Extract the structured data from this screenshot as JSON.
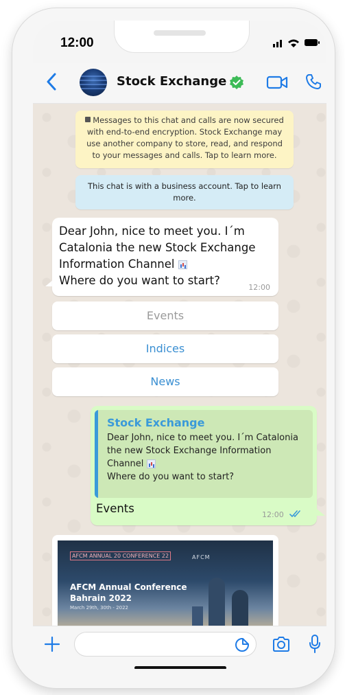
{
  "status": {
    "time": "12:00"
  },
  "header": {
    "contact_name": "Stock Exchange",
    "verified": true
  },
  "chat": {
    "encryption_notice": "Messages to this chat and calls are now secured with end-to-end encryption. Stock Exchange may use another company to store, read, and respond to your messages and calls. Tap to learn more.",
    "business_notice": "This chat is with a business account. Tap to learn more.",
    "incoming_message": {
      "line1": "Dear John, nice to meet you. I´m",
      "line2": "Catalonia the new Stock Exchange",
      "line3": "Information Channel",
      "line4": "Where do you want to start?",
      "time": "12:00"
    },
    "quick_replies": [
      {
        "label": "Events"
      },
      {
        "label": "Indices"
      },
      {
        "label": "News"
      }
    ],
    "outgoing_message": {
      "quoted_sender": "Stock Exchange",
      "quoted_line1": "Dear John, nice to meet you. I´m Catalonia",
      "quoted_line2": "the new Stock Exchange Information",
      "quoted_line3": "Channel",
      "quoted_line4": "Where do you want to start?",
      "text": "Events",
      "time": "12:00",
      "status": "read"
    },
    "card": {
      "tag": "AFCM ANNUAL 20 CONFERENCE 22",
      "logos": "AFCM",
      "title": "AFCM Annual Conference Bahrain 2022",
      "date": "March 29th, 30th - 2022"
    }
  },
  "input": {
    "placeholder": "",
    "value": ""
  },
  "colors": {
    "accent": "#1e7be6",
    "verified": "#3dbb57",
    "outgoing_bubble": "#d9fbc6",
    "incoming_bubble": "#ffffff",
    "link": "#3a8fd2"
  },
  "icons": [
    "back-icon",
    "verified-icon",
    "video-call-icon",
    "phone-icon",
    "plus-icon",
    "sticker-icon",
    "camera-icon",
    "microphone-icon",
    "read-ticks-icon"
  ]
}
